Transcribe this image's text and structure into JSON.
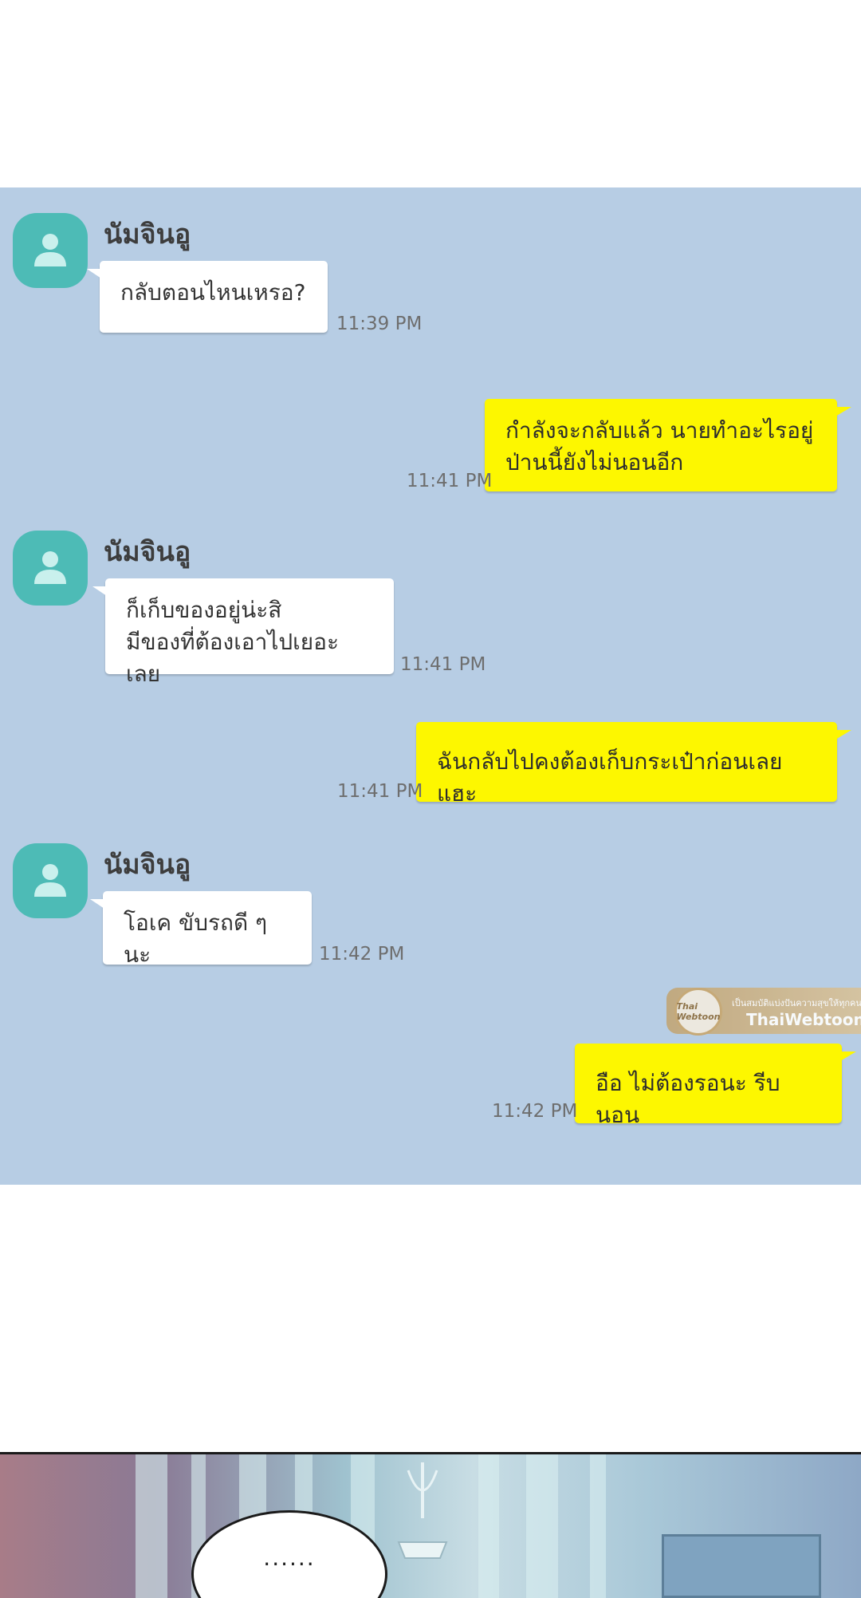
{
  "chat": {
    "background_color": "#b7cde4",
    "incoming_bubble_color": "#ffffff",
    "outgoing_bubble_color": "#fdf700",
    "avatar_color": "#4dbbb6",
    "messages": [
      {
        "sender": "นัมจินอู",
        "direction": "in",
        "lines": [
          "กลับตอนไหนเหรอ?"
        ],
        "time": "11:39 PM"
      },
      {
        "direction": "out",
        "lines": [
          "กำลังจะกลับแล้ว นายทำอะไรอยู่",
          "ป่านนี้ยังไม่นอนอีก"
        ],
        "time": "11:41 PM"
      },
      {
        "sender": "นัมจินอู",
        "direction": "in",
        "lines": [
          "ก็เก็บของอยู่น่ะสิ",
          "มีของที่ต้องเอาไปเยอะเลย"
        ],
        "time": "11:41 PM"
      },
      {
        "direction": "out",
        "lines": [
          "ฉันกลับไปคงต้องเก็บกระเป๋าก่อนเลยแฮะ"
        ],
        "time": "11:41 PM"
      },
      {
        "sender": "นัมจินอู",
        "direction": "in",
        "lines": [
          "โอเค ขับรถดี ๆ นะ"
        ],
        "time": "11:42 PM"
      },
      {
        "direction": "out",
        "lines": [
          "อือ ไม่ต้องรอนะ รีบนอน"
        ],
        "time": "11:42 PM"
      }
    ]
  },
  "watermark": {
    "badge": "Thai Webtoon",
    "tagline": "เป็นสมบัติแบ่งปันความสุขให้ทุกคน",
    "brand": "ThaiWebtoon"
  },
  "scene": {
    "speech_text": "......"
  }
}
